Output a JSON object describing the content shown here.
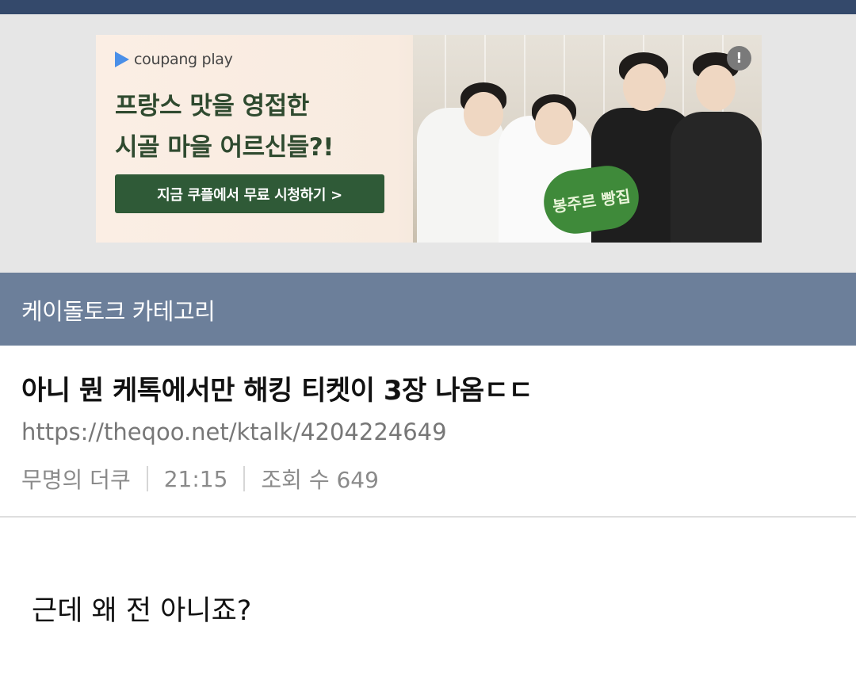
{
  "ad": {
    "brand": "coupang play",
    "headline_1": "프랑스 맛을 영접한",
    "headline_2": "시골 마을 어르신들?!",
    "cta": "지금 쿠플에서 무료 시청하기 >",
    "badge": "봉주르 빵집",
    "info_icon_label": "!",
    "cta_color": "#2f5a37",
    "headline_color": "#2f4a2f"
  },
  "category": {
    "title": "케이돌토크 카테고리",
    "bar_color": "#6c7f9a"
  },
  "post": {
    "title": "아니 뭔 케톡에서만 해킹 티켓이 3장 나옴ㄷㄷ",
    "url": "https://theqoo.net/ktalk/4204224649",
    "author": "무명의 더쿠",
    "time": "21:15",
    "views_label": "조회 수 649",
    "body": "근데 왜 전 아니죠?"
  },
  "colors": {
    "top_bar": "#34496b",
    "ad_background": "#e6e6e6"
  }
}
